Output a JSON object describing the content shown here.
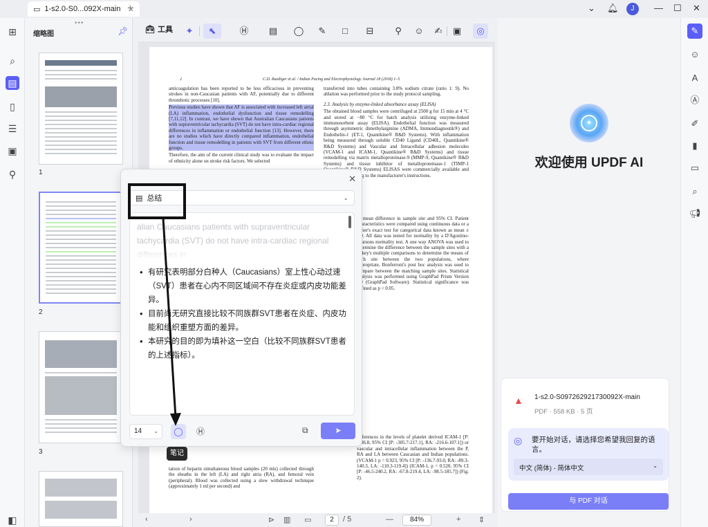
{
  "tab": {
    "title": "1-s2.0-S0...092X-main"
  },
  "avatar_letter": "J",
  "thumbnails": {
    "title": "缩略图",
    "pages": [
      "1",
      "2",
      "3"
    ]
  },
  "toolbar": {
    "tools_label": "工具"
  },
  "document": {
    "header_page": "2",
    "header_journal": "C.D. Ruediger et al. / Indian Pacing and Electrophysiology Journal 18 (2018) 1–5",
    "left_col": [
      "anticoagulation has been reported to be less efficacious in preventing strokes in non-Caucasian patients with AF, potentially due to different thrombotic processes [10].",
      "Previous studies have shown that AF is associated with increased left atrial (LA) inflammation, endothelial dysfunction and tissue remodelling [7,11,12]. In contrast, we have shown that Australian Caucasians patients with supraventricular tachycardia (SVT) do not have intra-cardiac regional differences in inflammation or endothelial function [13]. However, there are no studies which have directly compared inflammation, endothelial function and tissue remodelling in patients with SVT from different ethnic groups.",
      "Therefore, the aim of the current clinical study was to evaluate the impact of ethnicity alone on stroke risk factors. We selected"
    ],
    "left_col_bottom": "tation of heparin simultaneous blood samples (20 mls) collected through the sheaths in the left (LA) and right atria (RA), and femoral vein (peripheral). Blood was collected using a slow withdrawal technique (approximately 1 ml per second) and",
    "right_col_top": "transferred into tubes containing 3.8% sodium citrate (ratio 1: 9). No ablation was performed prior to the study protocol sampling.",
    "right_section": "2.3. Analysis by enzyme-linked absorbance assay (ELISA)",
    "right_col_mid": "The obtained blood samples were centrifuged at 2500 g for 15 min at 4 °C and stored at −80 °C for batch analysis utilizing enzyme-linked immunosorbent assay (ELISA). Endothelial function was measured through asymmetric dimethylarginine (ADMA, Immundiagnostik®) and Endothelin-1 (ET-1, Quantikine® R&D Systems). With inflammation being measured through soluble CD40 Ligand (CD40L, Quantikine® R&D Systems) and Vascular and Intracellular adhesion molecules (VCAM-1 and ICAM-1, Quantikine® R&D Systems) and tissue remodelling via matrix metalloproteinase-9 (MMP-9, Quantikine® R&D Systems) and tissue inhibitor of metalloproteinase-1 (TIMP-1 Quantikine® R&D Systems) ELISAS were commercially available and completed according to the manufacturer's instructions.",
    "right_col_lower": "as mean difference in sample site and 95% CI. Patient characteristics were compared using continuous data or a fisher's exact test for categorical data known as mean ± SD. All data was tested for normality by a D'Agostino-Pearsons normality test. A one way ANOVA was used to determine the difference between the sample sites with a Tukey's multiple comparisons to determine the means of each site between the two populations, where appropriate, Bonferroni's post hoc analysis was used to compare between the matching sample sites. Statistical analysis was performed using GraphPad Prism Version 7.0 (GraphPad Software). Statistical significance was defined as p < 0.05.",
    "right_col_bottom": "differences in the levels of platelet derived ICAM-1 [P: -306.8, 95% CI [P: -305.7-217.1], RA: -216.6-107.1]) or vascular and intracellular inflammation between the P, RA and LA between Caucasian and Indian populations. (VCAM-1 p = 0.923, 95% CI [P: -136.7-93.0, RA: -89.3-140.3, LA: -110.3-119.4]) (ICAM-1, p = 0.520, 95% CI [P: -46.5-240.2, RA: -67.8-219.4, LA: -98.5-185.7]) (Fig. 2)."
  },
  "dialog": {
    "mode": "总结",
    "source_text": "alian Caucasians patients with supraventricular tachycardia (SVT) do not have intra-cardiac regional differences in",
    "bullets": [
      "有研究表明部分白种人（Caucasians）室上性心动过速（SVT）患者在心内不同区域间不存在炎症或内皮功能差异。",
      "目前尚无研究直接比较不同族群SVT患者在炎症、内皮功能和组织重塑方面的差异。",
      "本研究的目的即为填补这一空白（比较不同族群SVT患者的上述指标）。"
    ],
    "font_size": "14",
    "tooltip": "笔记"
  },
  "bottombar": {
    "page_current": "2",
    "page_total": "/ 5",
    "zoom": "84%"
  },
  "ai": {
    "welcome": "欢迎使用 UPDF AI",
    "file_name": "1-s2.0-S097262921730092X-main",
    "file_meta": "PDF · 558 KB · 5 页",
    "lang_prompt": "要开始对话，请选择您希望我回复的语言。",
    "lang_selected": "中文 (简体) - 简体中文",
    "chat_button": "与 PDF 对话"
  },
  "colors": {
    "accent": "#5b5ef7",
    "highlight_blue": "#b9bff5",
    "highlight_green": "#bdf0b3"
  }
}
